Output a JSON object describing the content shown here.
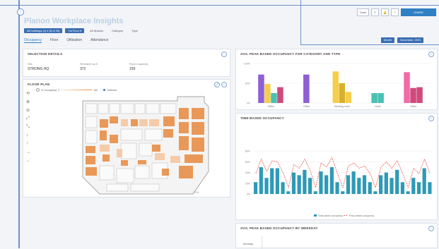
{
  "app": {
    "title": "Planon Workplace Insights"
  },
  "topbar": {
    "buttons": [
      {
        "label": "Tools"
      },
      {
        "label": "≡"
      },
      {
        "label": "🔔"
      },
      {
        "label": "?"
      }
    ],
    "primary_label": "SHARE"
  },
  "filters": {
    "chips": [
      {
        "label": "All buildings (4) ▾ (8 of 25)",
        "active": true
      },
      {
        "label": "1st Floor ▾",
        "active": true
      },
      {
        "label": "All Spaces",
        "active": false
      },
      {
        "label": "Category",
        "active": false
      },
      {
        "label": "Type",
        "active": false
      }
    ]
  },
  "tabs": [
    {
      "label": "Occupancy",
      "active": true
    },
    {
      "label": "Floor",
      "active": false
    },
    {
      "label": "Utilization",
      "active": false
    },
    {
      "label": "Attendance",
      "active": false
    }
  ],
  "date_nav": {
    "period": "Month",
    "range": "November, 2021"
  },
  "selection_details": {
    "title": "SELECTION DETAILS",
    "fields": [
      {
        "label": "Site",
        "value": "STRONG HQ"
      },
      {
        "label": "Rentable sq.ft",
        "value": "372"
      },
      {
        "label": "Room capacity",
        "value": "159"
      }
    ]
  },
  "floor_plan": {
    "title": "FLOOR PLAN",
    "legend_occupancy": "% Occupancy",
    "legend_min": "0",
    "legend_max": "100",
    "legend_selected": "Selected",
    "scale_label": "1:100",
    "tools": [
      "⟲",
      "⊕",
      "⊖",
      "⤢",
      "⤡",
      "↓",
      "↑",
      "→",
      "←"
    ]
  },
  "colors": {
    "accent": "#2f7fc4",
    "teal": "#2d9ab7",
    "red_line": "#e8463f",
    "purple": "#8e5fd6",
    "yellow": "#f6ce4a",
    "olive": "#d9b02d",
    "teal_light": "#49c1b3",
    "pink": "#f26aa8",
    "magenta": "#d04a7c",
    "floor_orange": "#e8893d"
  },
  "chart_data": [
    {
      "type": "bar",
      "title": "AVG. PEAK BASED OCCUPANCY FOR CATEGORY AND TYPE",
      "ylim": [
        0,
        100
      ],
      "yticks": [
        "0%",
        "50%",
        "100%"
      ],
      "groups": [
        {
          "label": "Office",
          "bars": [
            {
              "v": 72,
              "c": "#8e5fd6"
            },
            {
              "v": 48,
              "c": "#f6ce4a"
            },
            {
              "v": 25,
              "c": "#49c1b3"
            },
            {
              "v": 40,
              "c": "#d04a7c"
            }
          ]
        },
        {
          "label": "Office",
          "bars": [
            {
              "v": 72,
              "c": "#8e5fd6"
            }
          ]
        },
        {
          "label": "Meeting room",
          "bars": [
            {
              "v": 80,
              "c": "#f6ce4a"
            },
            {
              "v": 50,
              "c": "#d9b02d"
            },
            {
              "v": 28,
              "c": "#f6ce4a"
            }
          ]
        },
        {
          "label": "Desk",
          "bars": [
            {
              "v": 25,
              "c": "#49c1b3"
            },
            {
              "v": 25,
              "c": "#49c1b3"
            }
          ]
        },
        {
          "label": "Other",
          "bars": [
            {
              "v": 78,
              "c": "#f26aa8"
            },
            {
              "v": 38,
              "c": "#d04a7c"
            },
            {
              "v": 40,
              "c": "#d04a7c"
            }
          ]
        }
      ]
    },
    {
      "type": "bar",
      "title": "TIME-BASED OCCUPANCY",
      "ylim": [
        0,
        100
      ],
      "yticks": [
        "0%",
        "20%",
        "40%",
        "60%",
        "80%"
      ],
      "legend": [
        "Time-based occupancy",
        "Peak-based occupancy"
      ],
      "bars": [
        22,
        50,
        30,
        48,
        48,
        22,
        5,
        40,
        35,
        45,
        30,
        5,
        42,
        35,
        50,
        22,
        5,
        35,
        42,
        30,
        35,
        22,
        5,
        35,
        40,
        30,
        45,
        22,
        5,
        30,
        22,
        48,
        22
      ],
      "line": [
        38,
        65,
        42,
        62,
        60,
        40,
        12,
        55,
        48,
        65,
        44,
        12,
        58,
        50,
        68,
        38,
        12,
        52,
        58,
        48,
        52,
        38,
        12,
        50,
        60,
        48,
        62,
        38,
        12,
        48,
        38,
        65,
        38
      ]
    },
    {
      "type": "bar",
      "title": "AVG. PEAK BASED OCCUPANCY BY WEEKDAY",
      "yaxis_label": "Monday"
    }
  ]
}
